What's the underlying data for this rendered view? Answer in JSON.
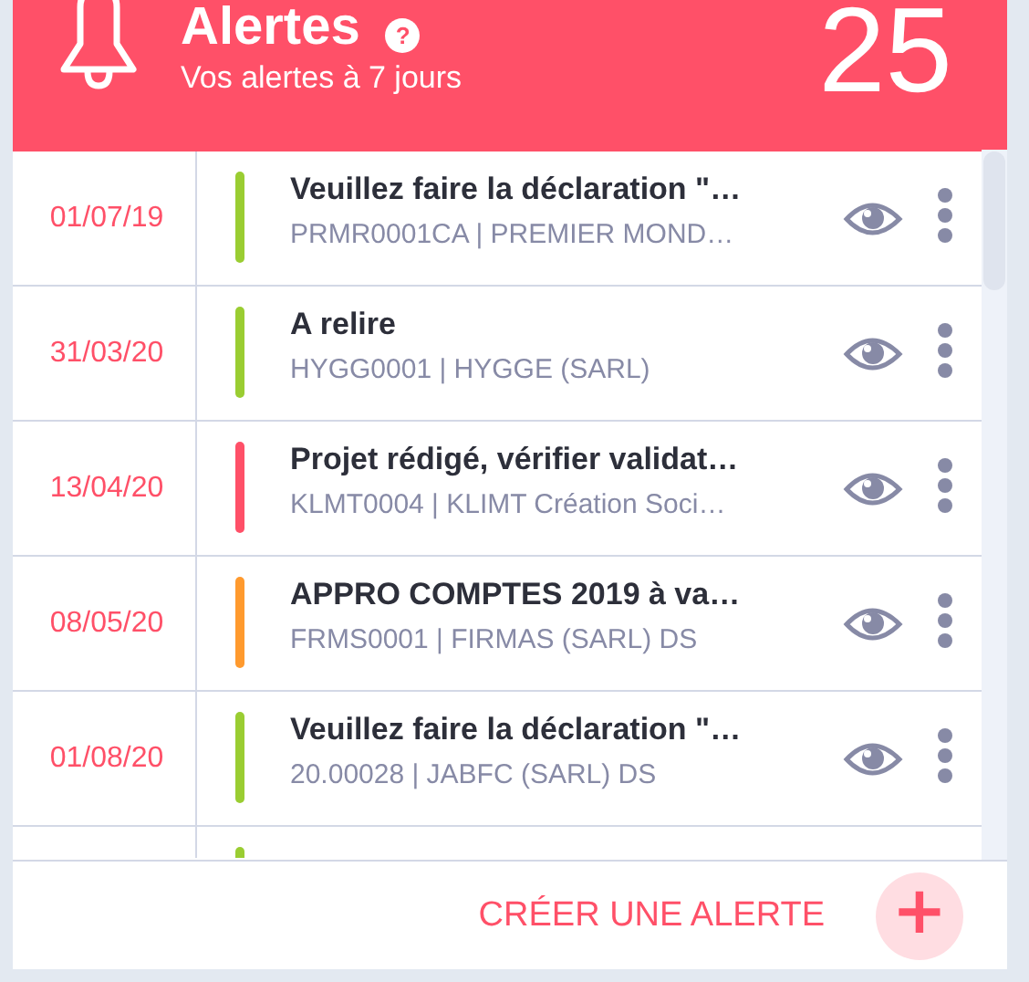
{
  "header": {
    "title": "Alertes",
    "help": "?",
    "subtitle": "Vos alertes à 7 jours",
    "count": "25"
  },
  "alerts": [
    {
      "kind": "full",
      "date": "01/07/19",
      "color": "#9acd32",
      "title": "Veuillez faire la déclaration \"…",
      "detail": "PRMR0001CA | PREMIER MOND…"
    },
    {
      "kind": "full",
      "date": "31/03/20",
      "color": "#9acd32",
      "title": "A relire",
      "detail": "HYGG0001 | HYGGE (SARL)"
    },
    {
      "kind": "full",
      "date": "13/04/20",
      "color": "#ff5068",
      "title": "Projet rédigé, vérifier validat…",
      "detail": "KLMT0004 | KLIMT Création Soci…"
    },
    {
      "kind": "full",
      "date": "08/05/20",
      "color": "#ff9a2e",
      "title": "APPRO COMPTES 2019 à va…",
      "detail": "FRMS0001 | FIRMAS (SARL) DS"
    },
    {
      "kind": "full",
      "date": "01/08/20",
      "color": "#9acd32",
      "title": "Veuillez faire la déclaration \"…",
      "detail": "20.00028 | JABFC (SARL) DS"
    },
    {
      "kind": "partial",
      "color": "#9acd32"
    }
  ],
  "footer": {
    "create_label": "CRÉER UNE ALERTE",
    "add_icon": "+"
  }
}
